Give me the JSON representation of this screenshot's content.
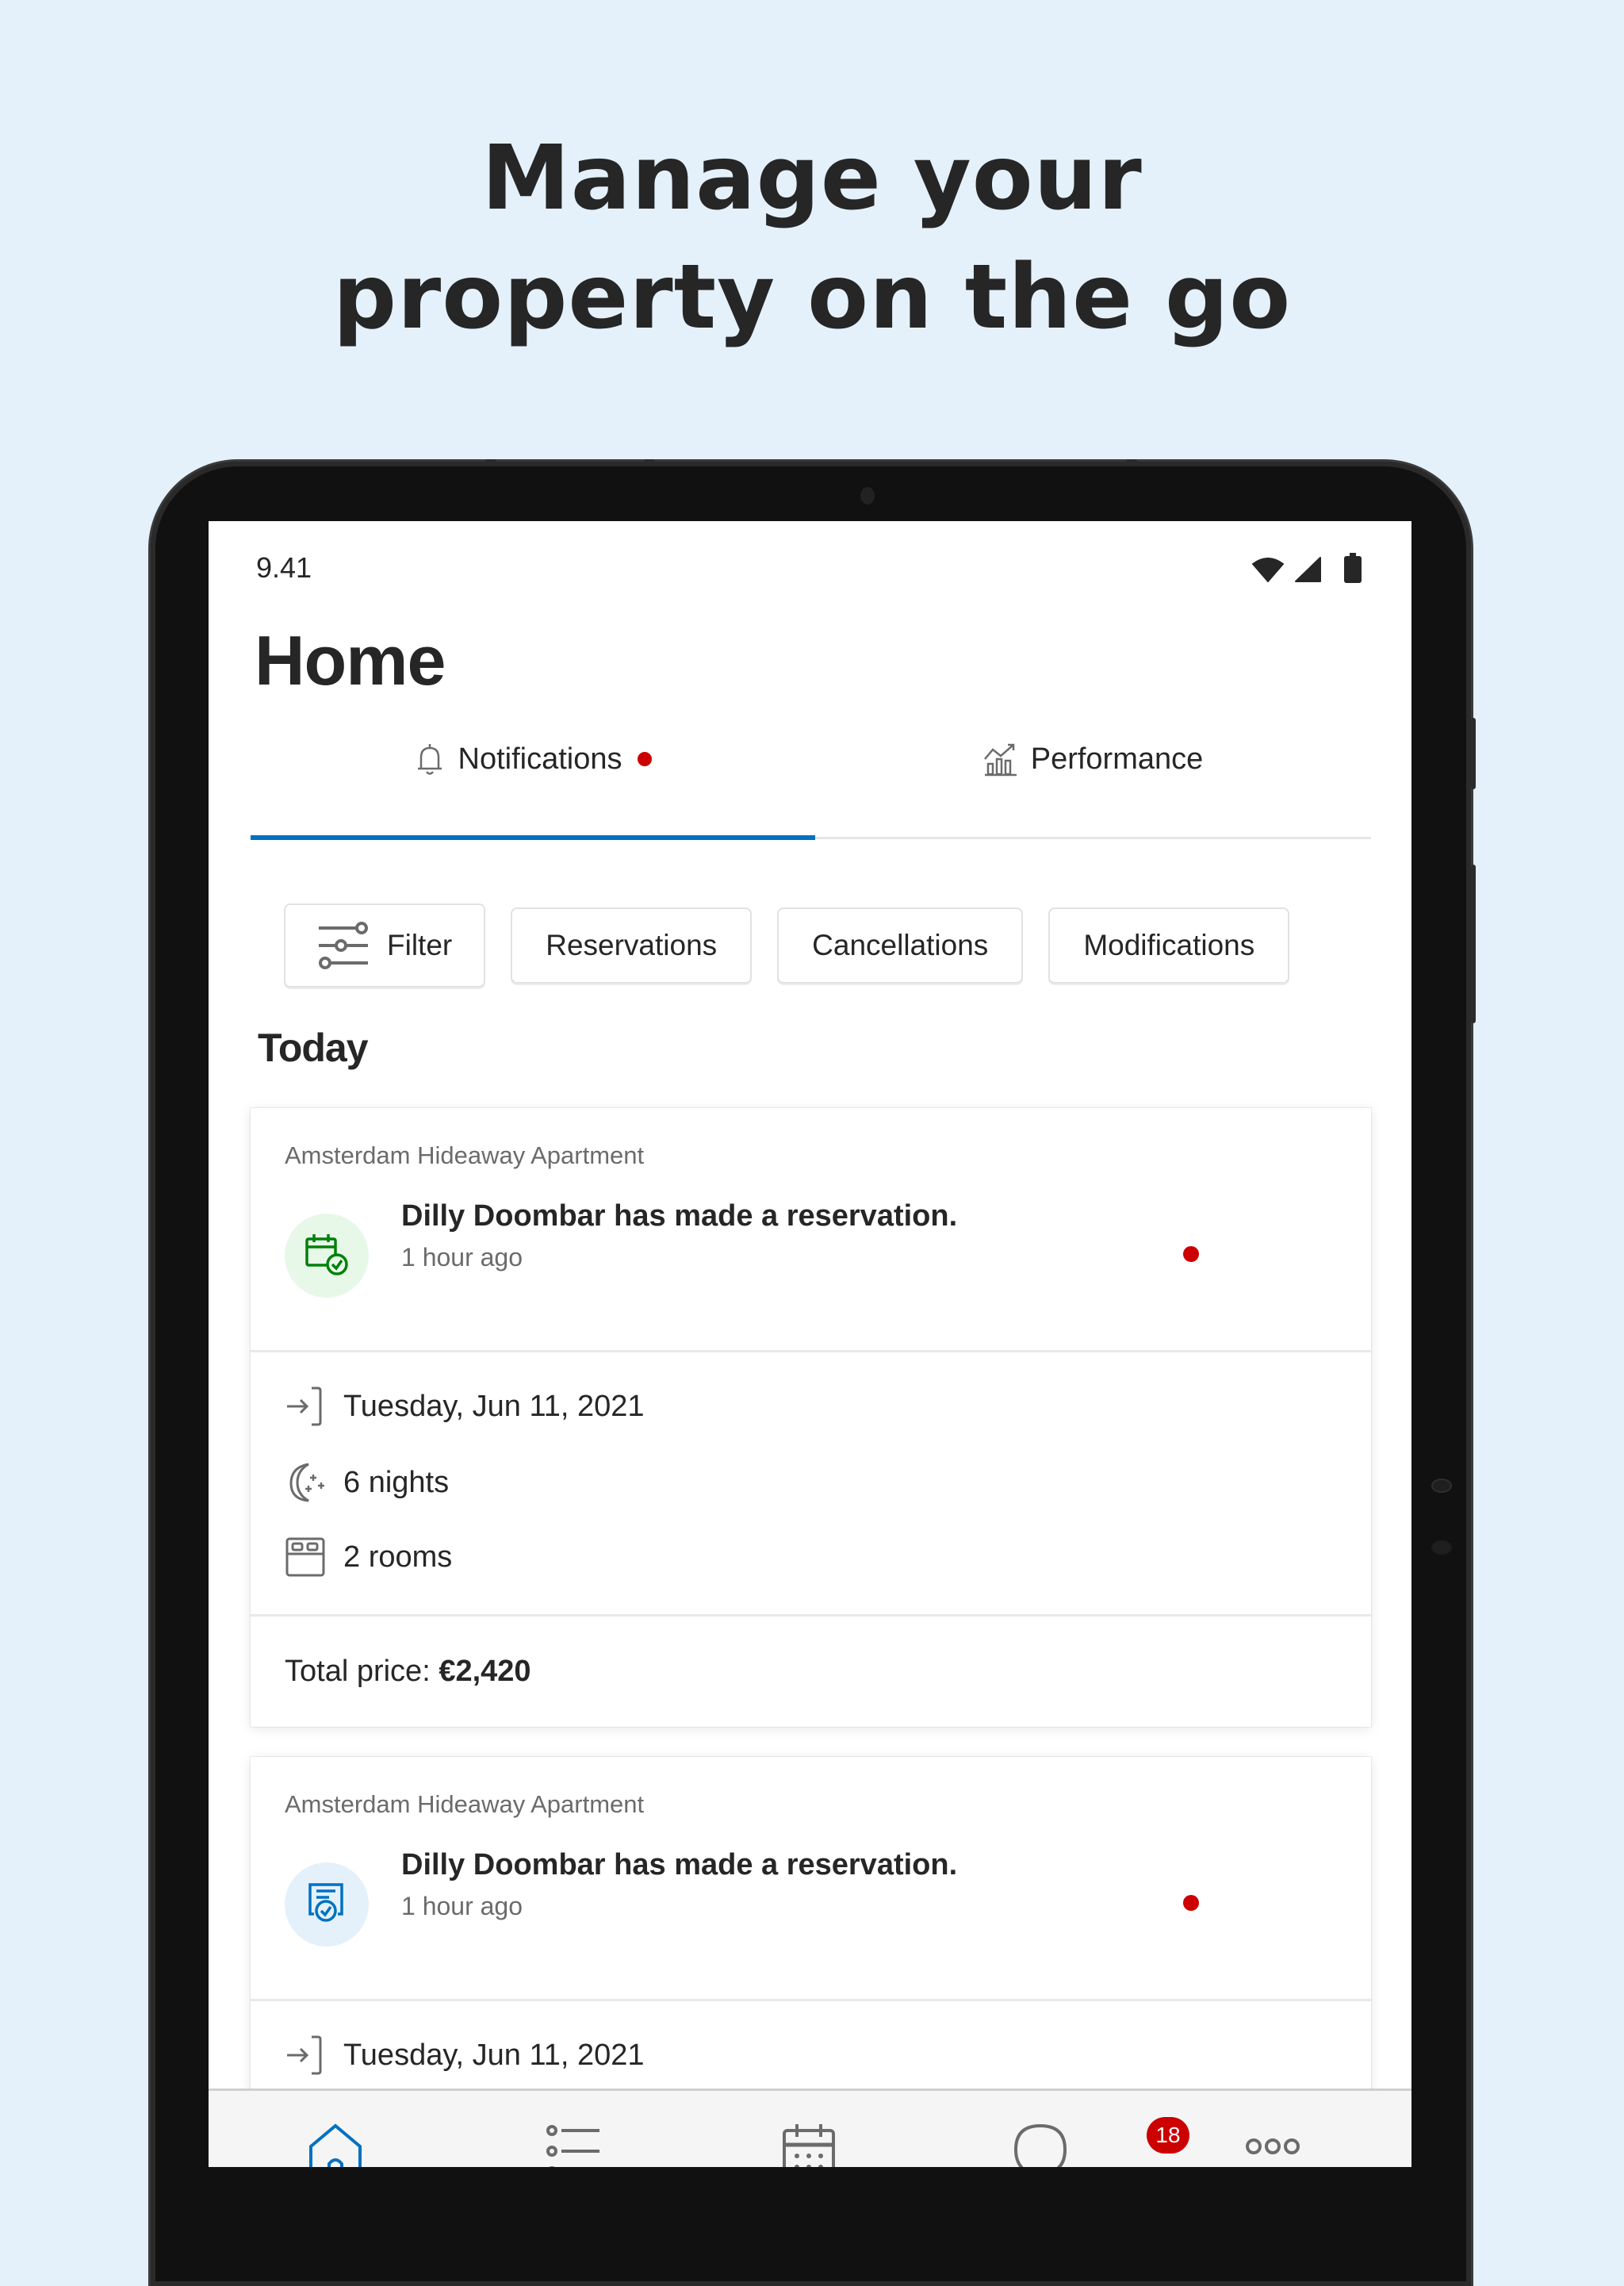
{
  "marketing": {
    "headline_line1": "Manage your",
    "headline_line2": "property on the go"
  },
  "status_bar": {
    "time": "9.41",
    "icons": [
      "wifi-icon",
      "signal-icon",
      "battery-icon"
    ]
  },
  "page": {
    "title": "Home"
  },
  "tabs": [
    {
      "label": "Notifications",
      "icon": "bell-icon",
      "active": true,
      "has_unread_dot": true
    },
    {
      "label": "Performance",
      "icon": "chart-trend-icon",
      "active": false
    }
  ],
  "filters": {
    "filter_label": "Filter",
    "chips": [
      "Reservations",
      "Cancellations",
      "Modifications"
    ]
  },
  "section": {
    "title": "Today"
  },
  "notifications": [
    {
      "property": "Amsterdam Hideaway Apartment",
      "message": "Dilly Doombar has made a reservation.",
      "time_ago": "1 hour ago",
      "icon": "calendar-check-icon",
      "icon_color": "#008009",
      "icon_bg": "#E7F8E9",
      "unread": true,
      "check_in": "Tuesday, Jun 11, 2021",
      "nights": "6 nights",
      "rooms": "2 rooms",
      "total_price_label": "Total price:",
      "total_price_value": "€2,420"
    },
    {
      "property": "Amsterdam Hideaway Apartment",
      "message": "Dilly Doombar has made a reservation.",
      "time_ago": "1 hour ago",
      "icon": "document-check-icon",
      "icon_color": "#0071C2",
      "icon_bg": "#E4F1FB",
      "unread": true,
      "check_in": "Tuesday, Jun 11, 2021"
    }
  ],
  "bottom_nav": {
    "items": [
      {
        "name": "home",
        "icon": "home-icon",
        "active": true
      },
      {
        "name": "reservations",
        "icon": "list-icon"
      },
      {
        "name": "calendar",
        "icon": "calendar-icon"
      },
      {
        "name": "messages",
        "icon": "chat-bubble-icon",
        "badge": "18"
      },
      {
        "name": "more",
        "icon": "more-dots-icon"
      }
    ]
  },
  "colors": {
    "background": "#E4F1FB",
    "accent_blue": "#0071C2",
    "unread_red": "#CC0000",
    "success_green": "#008009",
    "text_primary": "#262626",
    "text_secondary": "#6B6B6B"
  }
}
